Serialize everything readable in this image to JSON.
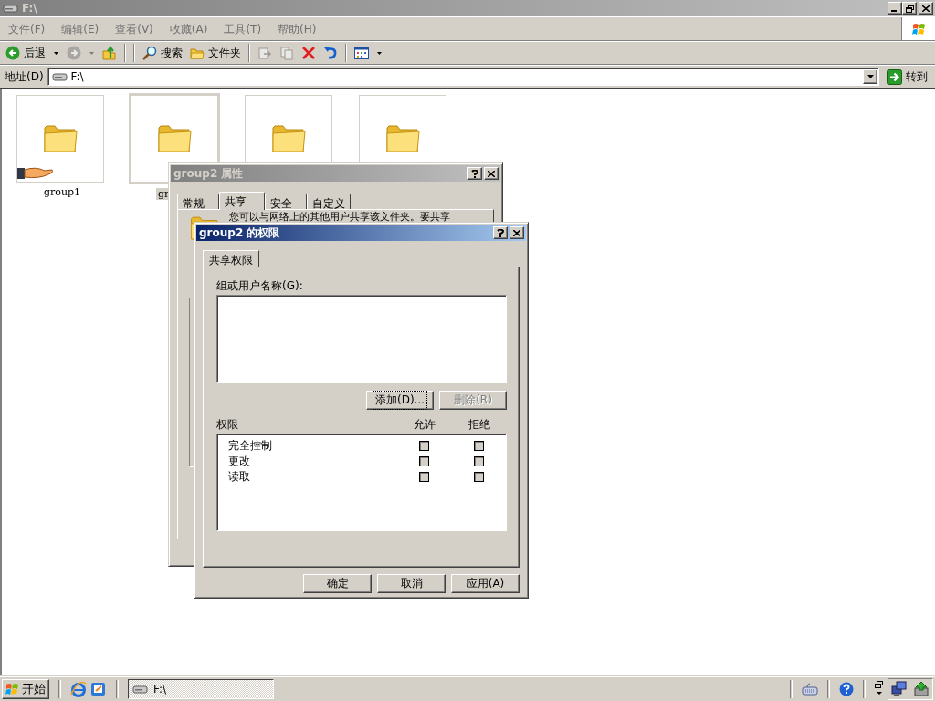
{
  "window": {
    "title": "F:\\"
  },
  "menu": [
    {
      "label": "文件(F)"
    },
    {
      "label": "编辑(E)"
    },
    {
      "label": "查看(V)"
    },
    {
      "label": "收藏(A)"
    },
    {
      "label": "工具(T)"
    },
    {
      "label": "帮助(H)"
    }
  ],
  "toolbar": [
    {
      "kind": "back",
      "label": "后退",
      "disabled": false
    },
    {
      "kind": "forward",
      "disabled": true
    },
    {
      "kind": "up",
      "disabled": false
    },
    {
      "kind": "search",
      "label": "搜索",
      "disabled": false
    },
    {
      "kind": "folders",
      "label": "文件夹",
      "disabled": false
    },
    {
      "kind": "move",
      "disabled": true
    },
    {
      "kind": "copy",
      "disabled": true
    },
    {
      "kind": "delete",
      "disabled": false
    },
    {
      "kind": "undo",
      "disabled": false
    },
    {
      "kind": "views",
      "disabled": false
    }
  ],
  "address": {
    "label": "地址(D)",
    "value": "F:\\",
    "go": "转到"
  },
  "files": [
    {
      "name": "group1",
      "shared": true,
      "selected": false
    },
    {
      "name": "gr",
      "shared": false,
      "selected": true
    },
    {
      "shared": false,
      "selected": false
    },
    {
      "shared": false,
      "selected": false
    }
  ],
  "properties_dialog": {
    "title": "group2 属性",
    "tabs": [
      {
        "label": "常规",
        "selected": false
      },
      {
        "label": "共享",
        "selected": true
      },
      {
        "label": "安全",
        "selected": false
      },
      {
        "label": "自定义",
        "selected": false
      }
    ],
    "text": "您可以与网络上的其他用户共享该文件夹。要共享"
  },
  "permissions_dialog": {
    "title": "group2 的权限",
    "tab": "共享权限",
    "users_label": "组或用户名称(G):",
    "buttons": [
      {
        "label": "添加(D)...",
        "disabled": false,
        "focused": true
      },
      {
        "label": "删除(R)",
        "disabled": true,
        "focused": false
      }
    ],
    "permissions_header": {
      "column_1": "权限",
      "allow": "允许",
      "deny": "拒绝"
    },
    "permissions": [
      {
        "name": "完全控制",
        "allow": false,
        "deny": false
      },
      {
        "name": "更改",
        "allow": false,
        "deny": false
      },
      {
        "name": "读取",
        "allow": false,
        "deny": false
      }
    ],
    "footer_buttons": [
      "确定",
      "取消",
      "应用(A)"
    ]
  },
  "taskbar": {
    "start": "开始",
    "tasks": [
      {
        "label": "F:\\",
        "selected": true
      }
    ]
  }
}
